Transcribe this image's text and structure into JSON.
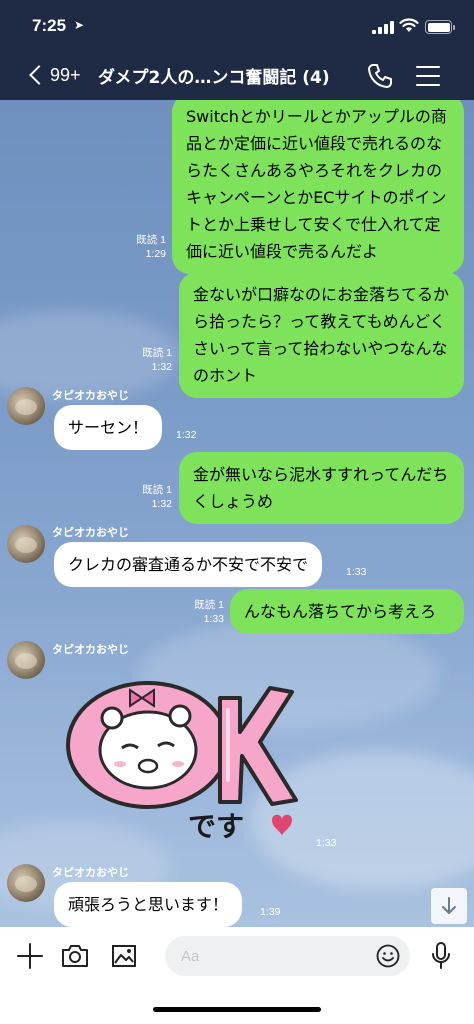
{
  "status_bar": {
    "time": "7:25"
  },
  "header": {
    "back_count": "99+",
    "title": "ダメプ2人の…ンコ奮闘記 (4)"
  },
  "messages": [
    {
      "side": "out",
      "text": "Switchとかリールとかアップルの商品とか定価に近い値段で売れるのならたくさんあるやろそれをクレカのキャンペーンとかECサイトのポイントとか上乗せして安くで仕入れて定価に近い値段で売るんだよ",
      "read": "既読 1",
      "time": "1:29"
    },
    {
      "side": "out",
      "text": "金ないが口癖なのにお金落ちてるから拾ったら？って教えてもめんどくさいって言って拾わないやつなんなのホント",
      "read": "既読 1",
      "time": "1:32"
    },
    {
      "side": "in",
      "sender": "タピオカおやじ",
      "text": "サーセン！",
      "time": "1:32"
    },
    {
      "side": "out",
      "text": "金が無いなら泥水すすれってんだちくしょうめ",
      "read": "既読 1",
      "time": "1:32"
    },
    {
      "side": "in",
      "sender": "タピオカおやじ",
      "text": "クレカの審査通るか不安で不安で",
      "time": "1:33"
    },
    {
      "side": "out",
      "text": "んなもん落ちてから考えろ",
      "read": "既読 1",
      "time": "1:33"
    },
    {
      "side": "in",
      "sender": "タピオカおやじ",
      "sticker": "OKです",
      "time": "1:33"
    },
    {
      "side": "in",
      "sender": "タピオカおやじ",
      "text": "頑張ろうと思います！",
      "time": "1:39"
    }
  ],
  "sticker": {
    "big_text": "OK",
    "small_text": "です"
  },
  "input": {
    "placeholder": "Aa"
  },
  "colors": {
    "header_bg": "#1f2a44",
    "outgoing_bubble": "#7ee35a",
    "incoming_bubble": "#ffffff",
    "chat_bg": "#7b9bc8"
  }
}
